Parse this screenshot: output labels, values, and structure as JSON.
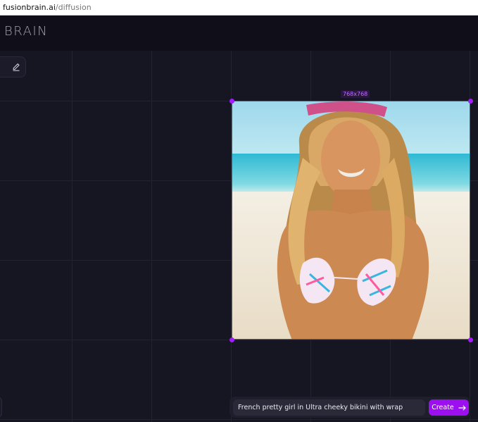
{
  "browser": {
    "url_host": "fusionbrain.ai",
    "url_path": "/diffusion"
  },
  "header": {
    "brand_text": "BRAIN"
  },
  "canvas": {
    "image_size_label": "768x768",
    "image_alt": "Generated image: smiling young woman with long blond hair and a colorful bikini on a sunny beach"
  },
  "prompt": {
    "value": "French pretty girl in Ultra cheeky bikini with wrap",
    "create_label": "Create"
  },
  "icons": {
    "edit": "pencil-icon",
    "create_arrow": "arrow-right-icon"
  },
  "colors": {
    "accent": "#a21cff",
    "button": "#9c10f0",
    "background": "#14131f"
  }
}
